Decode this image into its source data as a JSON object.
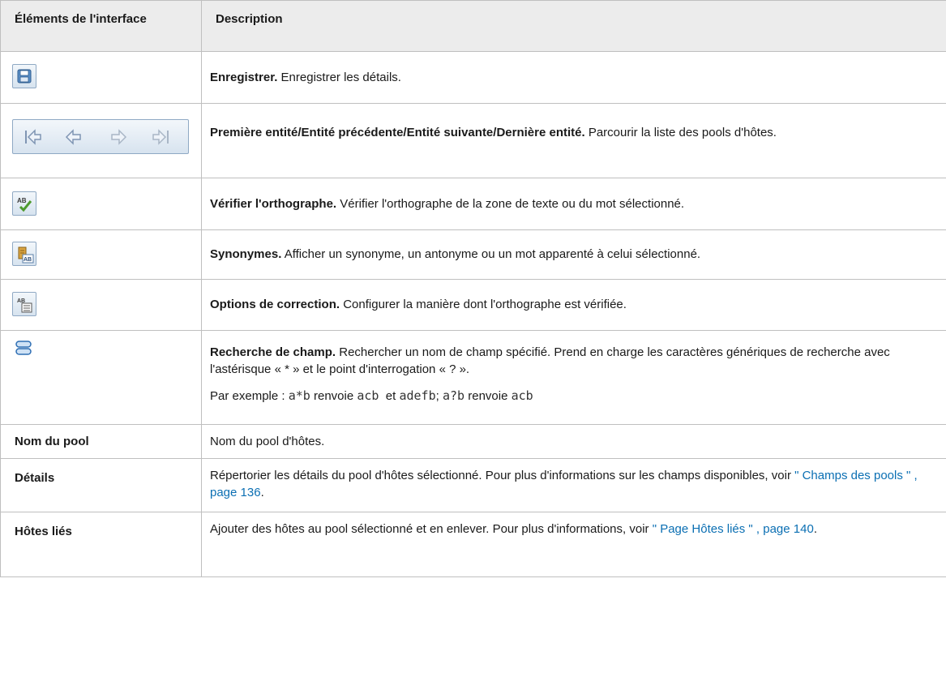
{
  "header": {
    "col_elements": "Éléments de l'interface",
    "col_description": "Description"
  },
  "rows": [
    {
      "icon": "save-icon",
      "title": "Enregistrer.",
      "text": "Enregistrer les détails."
    },
    {
      "icons": [
        "first-entity-icon",
        "previous-entity-icon",
        "next-entity-icon",
        "last-entity-icon"
      ],
      "title": "Première entité/Entité précédente/Entité suivante/Dernière entité.",
      "text": "Parcourir la liste des pools d'hôtes."
    },
    {
      "icon": "spell-check-icon",
      "title": "Vérifier l'orthographe.",
      "text": "Vérifier l'orthographe de la zone de texte ou du mot sélectionné."
    },
    {
      "icon": "thesaurus-icon",
      "title": "Synonymes.",
      "text": "Afficher un synonyme, un antonyme ou un mot apparenté à celui sélectionné."
    },
    {
      "icon": "spelling-options-icon",
      "title": "Options de correction.",
      "text": "Configurer la manière dont l'orthographe est vérifiée."
    },
    {
      "icon": "field-search-icon",
      "title": "Recherche de champ.",
      "text": "Rechercher un nom de champ spécifié. Prend en charge les caractères génériques de recherche avec l'astérisque « * » et le point d'interrogation « ? ».",
      "example_prefix": "Par exemple : ",
      "ex1_pattern": "a*b",
      "ex1_mid": " renvoie ",
      "ex1_result": "acb",
      "ex1_and": "  et ",
      "ex1_result2": "adefb",
      "ex1_sep": "; ",
      "ex2_pattern": "a?b",
      "ex2_mid": " renvoie ",
      "ex2_result": "acb"
    },
    {
      "label": "Nom du pool",
      "text": "Nom du pool d'hôtes."
    },
    {
      "label": "Détails",
      "text": "Répertorier les détails du pool d'hôtes sélectionné. Pour plus d'informations sur les champs disponibles, voir ",
      "link": "\" Champs des pools \" , page 136",
      "after": "."
    },
    {
      "label": "Hôtes liés",
      "text": "Ajouter des hôtes au pool sélectionné et en enlever. Pour plus d'informations, voir ",
      "link": "\" Page Hôtes liés \" , page 140",
      "after": "."
    }
  ]
}
